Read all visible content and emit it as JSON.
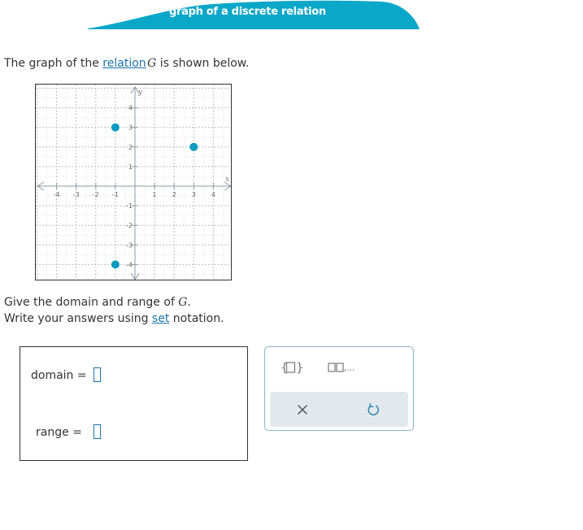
{
  "banner": {
    "title": "graph of a discrete relation",
    "color": "#0aa7c8"
  },
  "prompt": {
    "intro_before": "The graph of the ",
    "intro_link": "relation",
    "intro_var": "G",
    "intro_after": " is shown below."
  },
  "graph": {
    "x_label": "x",
    "y_label": "y",
    "x_ticks": [
      "-4",
      "-3",
      "-2",
      "-1",
      "1",
      "2",
      "3",
      "4"
    ],
    "y_ticks": [
      "4",
      "3",
      "2",
      "1",
      "-1",
      "-2",
      "-3",
      "-4"
    ],
    "point_color": "#0a9bbf"
  },
  "chart_data": {
    "type": "scatter",
    "x": [
      -1,
      3,
      -1
    ],
    "y": [
      3,
      2,
      -4
    ],
    "xlim": [
      -5,
      5
    ],
    "ylim": [
      -5,
      5
    ],
    "xlabel": "x",
    "ylabel": "y",
    "grid": true
  },
  "question": {
    "line1_before": "Give the domain and range of ",
    "line1_var": "G",
    "line1_after": ".",
    "line2_before": "Write your answers using ",
    "line2_link": "set",
    "line2_after": " notation."
  },
  "answers": {
    "domain_label": "domain =",
    "range_label": "range ="
  },
  "tools": {
    "set_braces_icon": "set-braces-icon",
    "list_icon_suffix": ",...",
    "clear_icon": "close-icon",
    "undo_icon": "undo-icon"
  }
}
